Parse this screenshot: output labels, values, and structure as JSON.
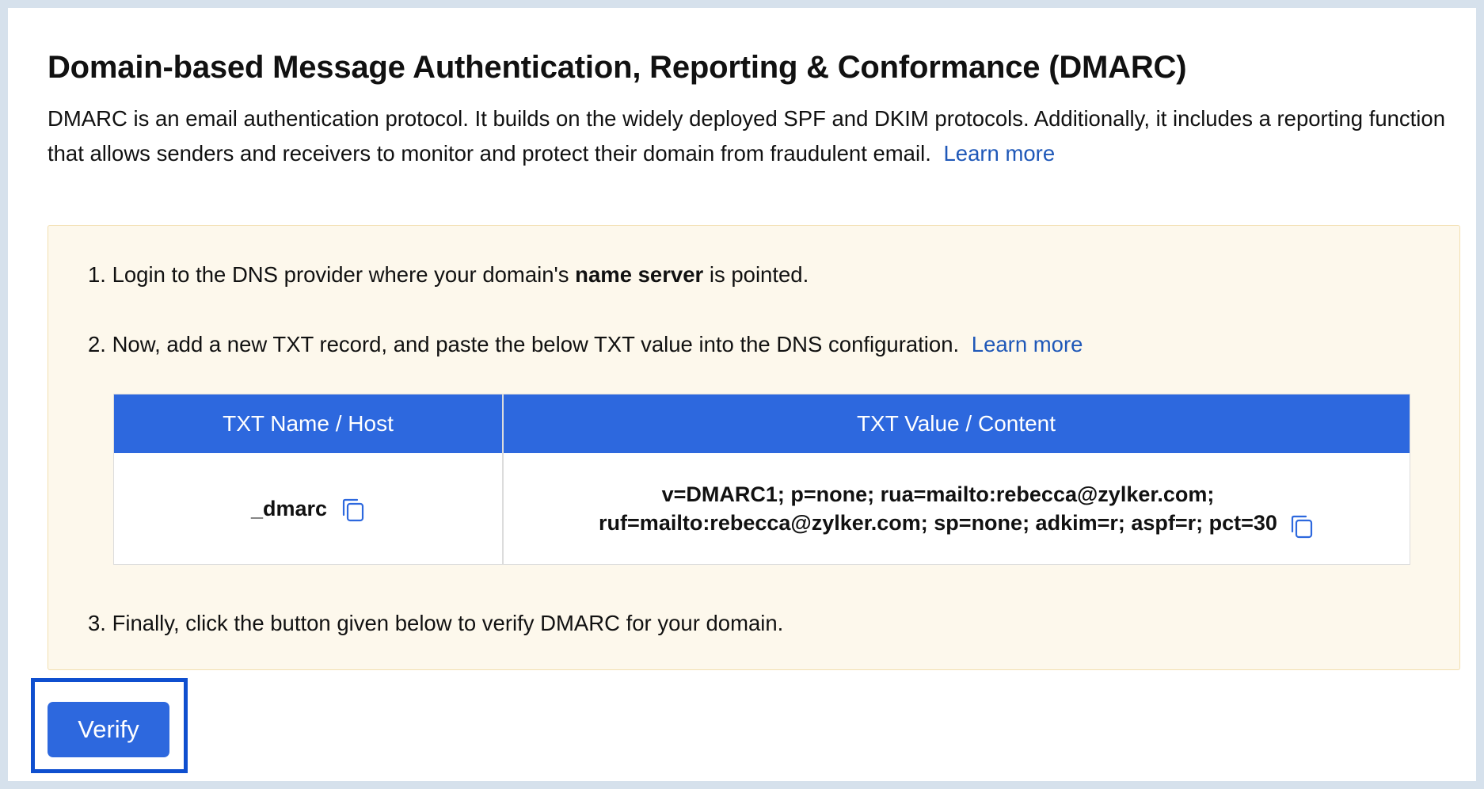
{
  "header": {
    "title": "Domain-based Message Authentication, Reporting & Conformance (DMARC)",
    "description": "DMARC is an email authentication protocol. It builds on the widely deployed SPF and DKIM protocols. Additionally, it includes a reporting function that allows senders and receivers to monitor and protect their domain from fraudulent email.",
    "learn_more": "Learn more"
  },
  "steps": {
    "step1_prefix": "1. Login to the DNS provider where your domain's ",
    "step1_bold": "name server",
    "step1_suffix": " is pointed.",
    "step2_text": "2. Now, add a new TXT record, and paste the below TXT value into the DNS configuration.",
    "step2_link": "Learn more",
    "step3_text": "3. Finally, click the button given below to verify DMARC for your domain."
  },
  "table": {
    "headers": [
      "TXT Name / Host",
      "TXT Value / Content"
    ],
    "row": {
      "name": "_dmarc",
      "value_line1": "v=DMARC1; p=none; rua=mailto:rebecca@zylker.com;",
      "value_line2": "ruf=mailto:rebecca@zylker.com; sp=none; adkim=r; aspf=r; pct=30"
    }
  },
  "actions": {
    "verify_label": "Verify"
  },
  "icons": {
    "copy": "copy-icon"
  },
  "colors": {
    "primary": "#2d68de",
    "link": "#1f58b8",
    "panel_background": "#fdf8ec",
    "panel_border": "#f2dfb0",
    "focus_ring": "#0f4fcf",
    "frame_border": "#d6e1ec"
  }
}
